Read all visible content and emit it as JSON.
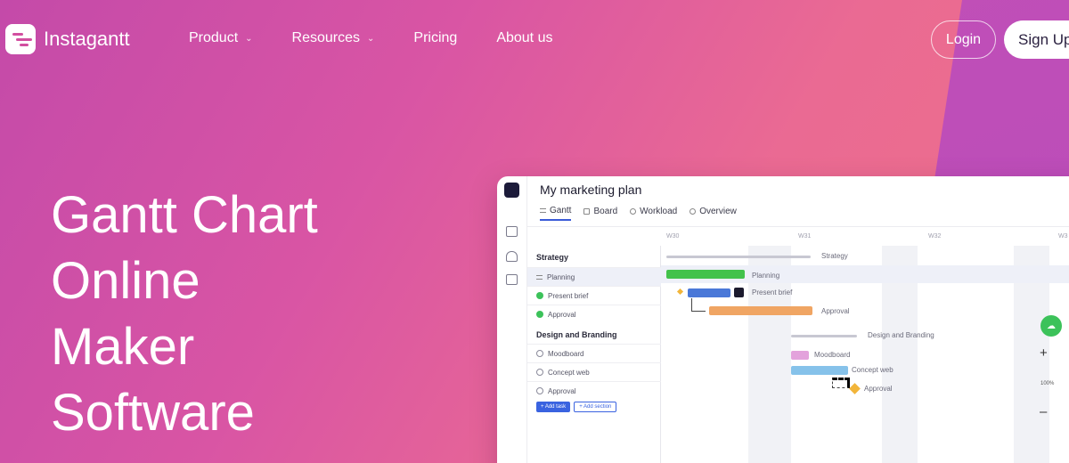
{
  "nav": {
    "logo_text": "Instagantt",
    "menu": [
      {
        "label": "Product",
        "has_dropdown": true
      },
      {
        "label": "Resources",
        "has_dropdown": true
      },
      {
        "label": "Pricing",
        "has_dropdown": false
      },
      {
        "label": "About us",
        "has_dropdown": false
      }
    ],
    "login_label": "Login",
    "signup_label": "Sign Up"
  },
  "hero": {
    "title_lines": [
      "Gantt Chart",
      "Online",
      "Maker",
      "Software"
    ]
  },
  "app": {
    "title": "My marketing plan",
    "tabs": [
      {
        "label": "Gantt",
        "active": true
      },
      {
        "label": "Board",
        "active": false
      },
      {
        "label": "Workload",
        "active": false
      },
      {
        "label": "Overview",
        "active": false
      }
    ],
    "weeks": [
      "W30",
      "W31",
      "W32",
      "W3"
    ],
    "sections": [
      {
        "title": "Strategy",
        "tasks": [
          {
            "label": "Planning",
            "status": "in-progress"
          },
          {
            "label": "Present brief",
            "status": "done"
          },
          {
            "label": "Approval",
            "status": "done"
          }
        ]
      },
      {
        "title": "Design and Branding",
        "tasks": [
          {
            "label": "Moodboard",
            "status": "open"
          },
          {
            "label": "Concept web",
            "status": "open"
          },
          {
            "label": "Approval",
            "status": "open"
          }
        ]
      }
    ],
    "add_task_label": "+ Add task",
    "add_section_label": "+ Add section",
    "chart_labels": {
      "strategy": "Strategy",
      "planning": "Planning",
      "present_brief": "Present brief",
      "approval": "Approval",
      "design": "Design and Branding",
      "moodboard": "Moodboard",
      "concept_web": "Concept web",
      "approval2": "Approval"
    },
    "zoom_plus": "+",
    "zoom_level": "100%",
    "zoom_minus": "–",
    "colors": {
      "planning": "#43c24b",
      "present_brief": "#4a78d8",
      "approval": "#f0a563",
      "moodboard": "#e3a2dc",
      "concept_web": "#86c2ea",
      "milestone": "#f2b53a"
    }
  }
}
